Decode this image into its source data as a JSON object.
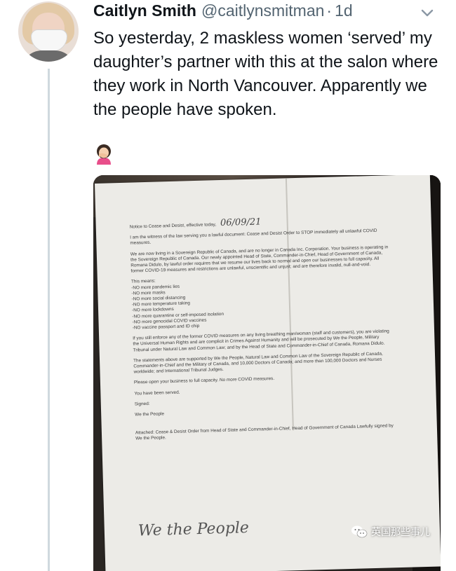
{
  "author": {
    "name": "Caitlyn Smith",
    "handle": "@caitlynsmitman",
    "separator": "·",
    "time": "1d"
  },
  "tweet": {
    "text": "So yesterday, 2 maskless women ‘served’ my daughter’s partner with this at the salon where they work in North Vancouver. Apparently we the people have spoken.",
    "emoji": "woman-facepalming-emoji"
  },
  "photo": {
    "notice_title": "Notice to Cease and Desist, effective today,",
    "notice_date": "06/09/21",
    "para_witness": "I am the witness of the law serving you a lawful document: Cease and Desist Order to STOP immediately all unlawful COVID measures.",
    "para_republic": "We are now living in a Sovereign Republic of Canada, and are no longer in Canada Inc. Corporation. Your business is operating in the Sovereign Republic of Canada. Our newly appointed Head of State, Commander-in-Chief, Head of Government of Canada, Romana Didulo, by lawful order requires that we resume our lives back to normal and open our businesses to full capacity. All former COVID-19 measures and restrictions are unlawful, unscientific and unjust; and are therefore invalid, null-and-void.",
    "means_heading": "This means:",
    "means_items": [
      "-NO more pandemic lies",
      "-NO more masks",
      "-NO more social distancing",
      "-NO more temperature taking",
      "-NO more lockdowns",
      "-NO more quarantine or self-imposed isolation",
      "-NO more genocidal COVID vaccines",
      "-NO vaccine passport and ID chip"
    ],
    "para_enforce": "If you still enforce any of the former COVID measures on any living breathing man/woman (staff and customers), you are violating the Universal Human Rights and are complicit in Crimes Against Humanity and will be prosecuted by We the People, Military Tribunal under Natural Law and Common Law; and by the Head of State and Commander-in-Chief of Canada, Romana Didulo.",
    "para_statements": "The statements above are supported by We the People, Natural Law and Common Law of the Sovereign Republic of Canada, Commander-in-Chief and the Military of Canada, and 10,000 Doctors of Canada; and more than 100,000 Doctors and Nurses worldwide; and International Tribunal Judges.",
    "para_open": "Please open your business to full capacity. No more COVID measures.",
    "served": "You have been served.",
    "signed": "Signed:",
    "we_the_people": "We the People",
    "signature": "We the People",
    "attached": "Attached: Cease & Desist Order from Head of State and Commander-in-Chief, Head of Government of Canada Lawfully signed by We the People."
  },
  "watermark": {
    "label": "英国那些事儿",
    "icon": "wechat-icon"
  },
  "colors": {
    "text": "#0f1419",
    "secondary": "#536471",
    "thread_line": "#cfd9de"
  }
}
